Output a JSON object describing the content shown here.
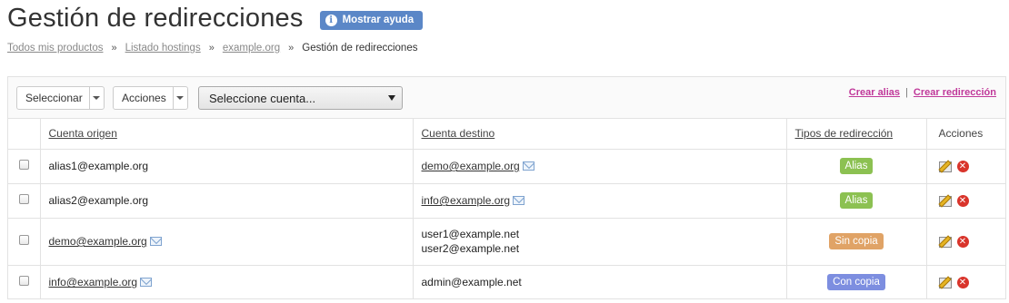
{
  "header": {
    "title": "Gestión de redirecciones",
    "help_button": "Mostrar ayuda",
    "help_color": "#5b87c7"
  },
  "breadcrumb": {
    "items": [
      "Todos mis productos",
      "Listado hostings",
      "example.org"
    ],
    "current": "Gestión de redirecciones",
    "separator": "»"
  },
  "toolbar": {
    "select_label": "Seleccionar",
    "actions_label": "Acciones",
    "account_select": "Seleccione cuenta...",
    "create_alias": "Crear alias",
    "separator": "|",
    "create_redirect": "Crear redirección",
    "link_color": "#c0389a"
  },
  "table": {
    "columns": {
      "source": "Cuenta origen",
      "destination": "Cuenta destino",
      "type": "Tipos de redirección",
      "actions": "Acciones"
    },
    "rows": [
      {
        "source": "alias1@example.org",
        "source_is_link": false,
        "destinations": [
          "demo@example.org"
        ],
        "dest_is_link": true,
        "type": "Alias",
        "type_color": "#8cc152"
      },
      {
        "source": "alias2@example.org",
        "source_is_link": false,
        "destinations": [
          "info@example.org"
        ],
        "dest_is_link": true,
        "type": "Alias",
        "type_color": "#8cc152"
      },
      {
        "source": "demo@example.org",
        "source_is_link": true,
        "destinations": [
          "user1@example.net",
          "user2@example.net"
        ],
        "dest_is_link": false,
        "type": "Sin copia",
        "type_color": "#e0a366"
      },
      {
        "source": "info@example.org",
        "source_is_link": true,
        "destinations": [
          "admin@example.net"
        ],
        "dest_is_link": false,
        "type": "Con copia",
        "type_color": "#7d8ee0"
      }
    ]
  }
}
